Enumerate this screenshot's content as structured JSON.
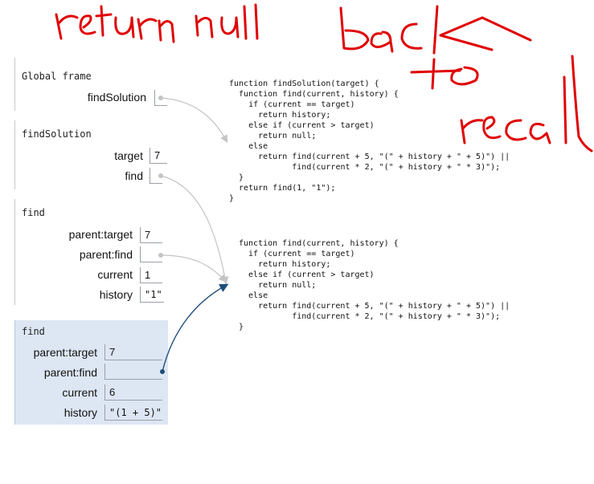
{
  "annotation": {
    "words": [
      "return",
      "null",
      "back",
      "to",
      "recall"
    ],
    "color": "#e00000"
  },
  "frames": [
    {
      "title": "Global frame",
      "vars": [
        {
          "name": "findSolution",
          "value": ""
        }
      ]
    },
    {
      "title": "findSolution",
      "vars": [
        {
          "name": "target",
          "value": "7"
        },
        {
          "name": "find",
          "value": ""
        }
      ]
    },
    {
      "title": "find",
      "vars": [
        {
          "name": "parent:target",
          "value": "7"
        },
        {
          "name": "parent:find",
          "value": ""
        },
        {
          "name": "current",
          "value": "1"
        },
        {
          "name": "history",
          "value": "\"1\""
        }
      ]
    },
    {
      "title": "find",
      "vars": [
        {
          "name": "parent:target",
          "value": "7"
        },
        {
          "name": "parent:find",
          "value": ""
        },
        {
          "name": "current",
          "value": "6"
        },
        {
          "name": "history",
          "value": "\"(1 + 5)\""
        }
      ]
    }
  ],
  "code_objects": [
    {
      "lines": "function findSolution(target) {\n  function find(current, history) {\n    if (current == target)\n      return history;\n    else if (current > target)\n      return null;\n    else\n      return find(current + 5, \"(\" + history + \" + 5)\") ||\n             find(current * 2, \"(\" + history + \" * 3)\");\n  }\n  return find(1, \"1\");\n}"
    },
    {
      "lines": "function find(current, history) {\n  if (current == target)\n    return history;\n  else if (current > target)\n    return null;\n  else\n    return find(current + 5, \"(\" + history + \" + 5)\") ||\n           find(current * 2, \"(\" + history + \" * 3)\");\n}"
    }
  ],
  "colors": {
    "pointer_inactive": "#c4c4c4",
    "pointer_active": "#1f4e79",
    "active_frame_bg": "#dde6f3"
  }
}
